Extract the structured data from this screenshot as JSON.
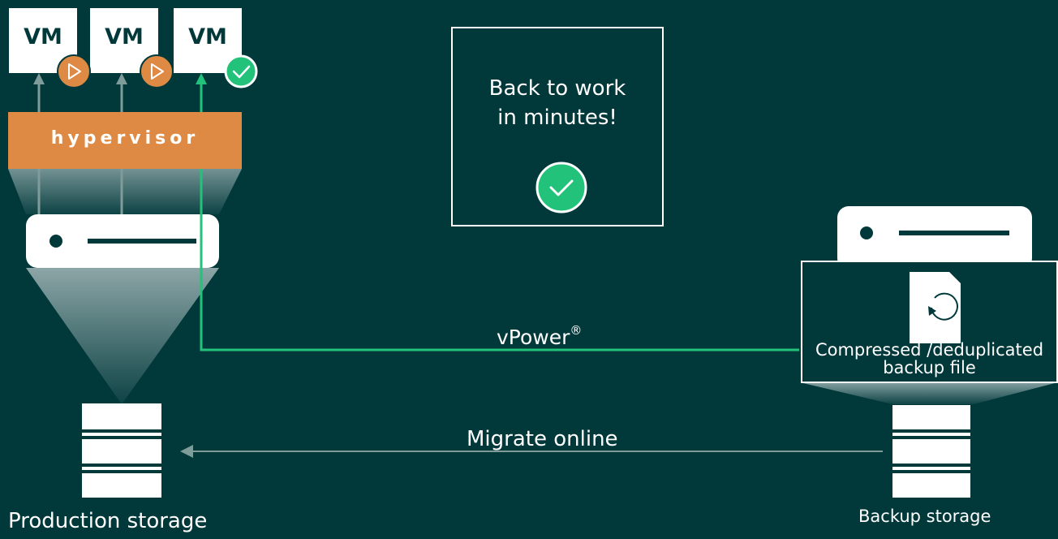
{
  "vms": [
    {
      "label": "VM",
      "status": "play-icon"
    },
    {
      "label": "VM",
      "status": "play-icon"
    },
    {
      "label": "VM",
      "status": "check-icon"
    }
  ],
  "hypervisor": {
    "label": "hypervisor"
  },
  "callout": {
    "line1": "Back to work",
    "line2": "in minutes!"
  },
  "connections": {
    "vpower": {
      "label": "vPower",
      "mark": "®"
    },
    "migrate": {
      "label": "Migrate online"
    }
  },
  "backup_file": {
    "line1": "Compressed /deduplicated",
    "line2": "backup file"
  },
  "storage": {
    "production": "Production storage",
    "backup": "Backup storage"
  },
  "colors": {
    "background": "#01393b",
    "accent_green": "#23c27b",
    "hypervisor_orange": "#de8a44",
    "arrow_gray": "#7f9c9a"
  }
}
